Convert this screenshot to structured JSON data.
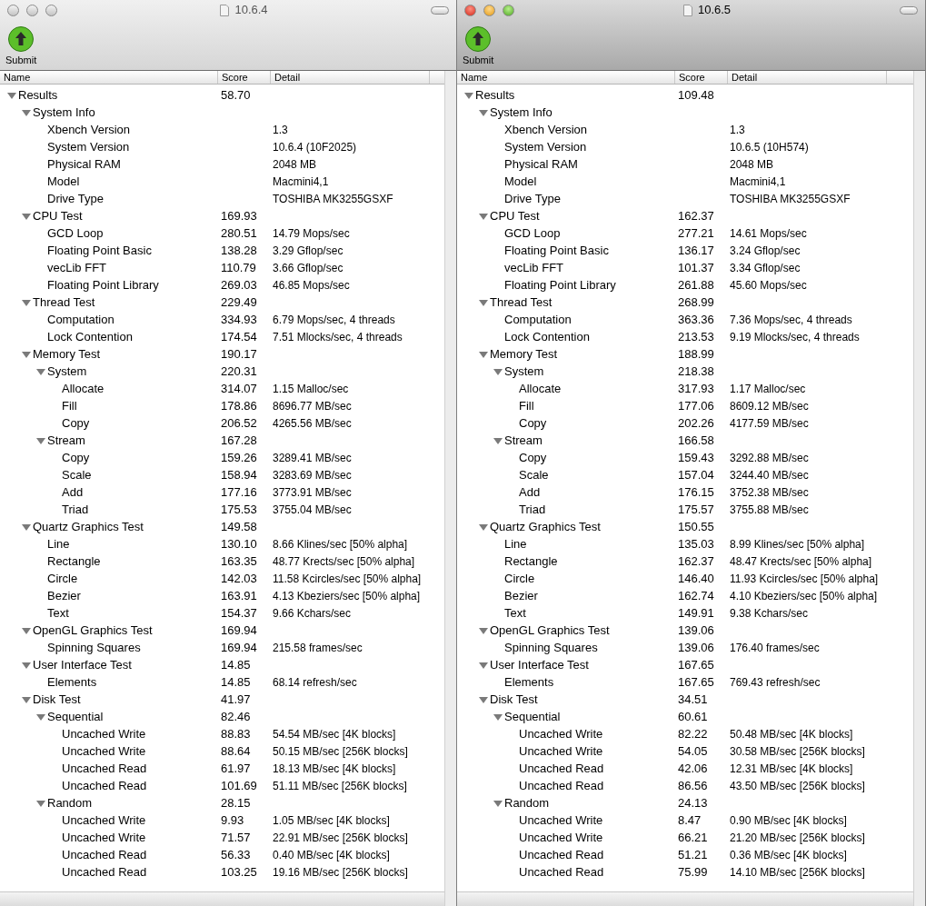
{
  "windows": [
    {
      "title": "10.6.4",
      "active": false,
      "toolbar": [
        {
          "label": "Submit"
        }
      ],
      "columns": [
        "Name",
        "Score",
        "Detail"
      ],
      "rows": [
        {
          "name": "Results",
          "score": "58.70",
          "expanded": true,
          "children": [
            {
              "name": "System Info",
              "expanded": true,
              "children": [
                {
                  "name": "Xbench Version",
                  "detail": "1.3"
                },
                {
                  "name": "System Version",
                  "detail": "10.6.4 (10F2025)"
                },
                {
                  "name": "Physical RAM",
                  "detail": "2048 MB"
                },
                {
                  "name": "Model",
                  "detail": "Macmini4,1"
                },
                {
                  "name": "Drive Type",
                  "detail": "TOSHIBA MK3255GSXF"
                }
              ]
            },
            {
              "name": "CPU Test",
              "score": "169.93",
              "expanded": true,
              "children": [
                {
                  "name": "GCD Loop",
                  "score": "280.51",
                  "detail": "14.79 Mops/sec"
                },
                {
                  "name": "Floating Point Basic",
                  "score": "138.28",
                  "detail": "3.29 Gflop/sec"
                },
                {
                  "name": "vecLib FFT",
                  "score": "110.79",
                  "detail": "3.66 Gflop/sec"
                },
                {
                  "name": "Floating Point Library",
                  "score": "269.03",
                  "detail": "46.85 Mops/sec"
                }
              ]
            },
            {
              "name": "Thread Test",
              "score": "229.49",
              "expanded": true,
              "children": [
                {
                  "name": "Computation",
                  "score": "334.93",
                  "detail": "6.79 Mops/sec, 4 threads"
                },
                {
                  "name": "Lock Contention",
                  "score": "174.54",
                  "detail": "7.51 Mlocks/sec, 4 threads"
                }
              ]
            },
            {
              "name": "Memory Test",
              "score": "190.17",
              "expanded": true,
              "children": [
                {
                  "name": "System",
                  "score": "220.31",
                  "expanded": true,
                  "children": [
                    {
                      "name": "Allocate",
                      "score": "314.07",
                      "detail": "1.15 Malloc/sec"
                    },
                    {
                      "name": "Fill",
                      "score": "178.86",
                      "detail": "8696.77 MB/sec"
                    },
                    {
                      "name": "Copy",
                      "score": "206.52",
                      "detail": "4265.56 MB/sec"
                    }
                  ]
                },
                {
                  "name": "Stream",
                  "score": "167.28",
                  "expanded": true,
                  "children": [
                    {
                      "name": "Copy",
                      "score": "159.26",
                      "detail": "3289.41 MB/sec"
                    },
                    {
                      "name": "Scale",
                      "score": "158.94",
                      "detail": "3283.69 MB/sec"
                    },
                    {
                      "name": "Add",
                      "score": "177.16",
                      "detail": "3773.91 MB/sec"
                    },
                    {
                      "name": "Triad",
                      "score": "175.53",
                      "detail": "3755.04 MB/sec"
                    }
                  ]
                }
              ]
            },
            {
              "name": "Quartz Graphics Test",
              "score": "149.58",
              "expanded": true,
              "children": [
                {
                  "name": "Line",
                  "score": "130.10",
                  "detail": "8.66 Klines/sec [50% alpha]"
                },
                {
                  "name": "Rectangle",
                  "score": "163.35",
                  "detail": "48.77 Krects/sec [50% alpha]"
                },
                {
                  "name": "Circle",
                  "score": "142.03",
                  "detail": "11.58 Kcircles/sec [50% alpha]"
                },
                {
                  "name": "Bezier",
                  "score": "163.91",
                  "detail": "4.13 Kbeziers/sec [50% alpha]"
                },
                {
                  "name": "Text",
                  "score": "154.37",
                  "detail": "9.66 Kchars/sec"
                }
              ]
            },
            {
              "name": "OpenGL Graphics Test",
              "score": "169.94",
              "expanded": true,
              "children": [
                {
                  "name": "Spinning Squares",
                  "score": "169.94",
                  "detail": "215.58 frames/sec"
                }
              ]
            },
            {
              "name": "User Interface Test",
              "score": "14.85",
              "expanded": true,
              "children": [
                {
                  "name": "Elements",
                  "score": "14.85",
                  "detail": "68.14 refresh/sec"
                }
              ]
            },
            {
              "name": "Disk Test",
              "score": "41.97",
              "expanded": true,
              "children": [
                {
                  "name": "Sequential",
                  "score": "82.46",
                  "expanded": true,
                  "children": [
                    {
                      "name": "Uncached Write",
                      "score": "88.83",
                      "detail": "54.54 MB/sec [4K blocks]"
                    },
                    {
                      "name": "Uncached Write",
                      "score": "88.64",
                      "detail": "50.15 MB/sec [256K blocks]"
                    },
                    {
                      "name": "Uncached Read",
                      "score": "61.97",
                      "detail": "18.13 MB/sec [4K blocks]"
                    },
                    {
                      "name": "Uncached Read",
                      "score": "101.69",
                      "detail": "51.11 MB/sec [256K blocks]"
                    }
                  ]
                },
                {
                  "name": "Random",
                  "score": "28.15",
                  "expanded": true,
                  "children": [
                    {
                      "name": "Uncached Write",
                      "score": "9.93",
                      "detail": "1.05 MB/sec [4K blocks]"
                    },
                    {
                      "name": "Uncached Write",
                      "score": "71.57",
                      "detail": "22.91 MB/sec [256K blocks]"
                    },
                    {
                      "name": "Uncached Read",
                      "score": "56.33",
                      "detail": "0.40 MB/sec [4K blocks]"
                    },
                    {
                      "name": "Uncached Read",
                      "score": "103.25",
                      "detail": "19.16 MB/sec [256K blocks]"
                    }
                  ]
                }
              ]
            }
          ]
        }
      ]
    },
    {
      "title": "10.6.5",
      "active": true,
      "toolbar": [
        {
          "label": "Submit"
        }
      ],
      "columns": [
        "Name",
        "Score",
        "Detail"
      ],
      "rows": [
        {
          "name": "Results",
          "score": "109.48",
          "expanded": true,
          "children": [
            {
              "name": "System Info",
              "expanded": true,
              "children": [
                {
                  "name": "Xbench Version",
                  "detail": "1.3"
                },
                {
                  "name": "System Version",
                  "detail": "10.6.5 (10H574)"
                },
                {
                  "name": "Physical RAM",
                  "detail": "2048 MB"
                },
                {
                  "name": "Model",
                  "detail": "Macmini4,1"
                },
                {
                  "name": "Drive Type",
                  "detail": "TOSHIBA MK3255GSXF"
                }
              ]
            },
            {
              "name": "CPU Test",
              "score": "162.37",
              "expanded": true,
              "children": [
                {
                  "name": "GCD Loop",
                  "score": "277.21",
                  "detail": "14.61 Mops/sec"
                },
                {
                  "name": "Floating Point Basic",
                  "score": "136.17",
                  "detail": "3.24 Gflop/sec"
                },
                {
                  "name": "vecLib FFT",
                  "score": "101.37",
                  "detail": "3.34 Gflop/sec"
                },
                {
                  "name": "Floating Point Library",
                  "score": "261.88",
                  "detail": "45.60 Mops/sec"
                }
              ]
            },
            {
              "name": "Thread Test",
              "score": "268.99",
              "expanded": true,
              "children": [
                {
                  "name": "Computation",
                  "score": "363.36",
                  "detail": "7.36 Mops/sec, 4 threads"
                },
                {
                  "name": "Lock Contention",
                  "score": "213.53",
                  "detail": "9.19 Mlocks/sec, 4 threads"
                }
              ]
            },
            {
              "name": "Memory Test",
              "score": "188.99",
              "expanded": true,
              "children": [
                {
                  "name": "System",
                  "score": "218.38",
                  "expanded": true,
                  "children": [
                    {
                      "name": "Allocate",
                      "score": "317.93",
                      "detail": "1.17 Malloc/sec"
                    },
                    {
                      "name": "Fill",
                      "score": "177.06",
                      "detail": "8609.12 MB/sec"
                    },
                    {
                      "name": "Copy",
                      "score": "202.26",
                      "detail": "4177.59 MB/sec"
                    }
                  ]
                },
                {
                  "name": "Stream",
                  "score": "166.58",
                  "expanded": true,
                  "children": [
                    {
                      "name": "Copy",
                      "score": "159.43",
                      "detail": "3292.88 MB/sec"
                    },
                    {
                      "name": "Scale",
                      "score": "157.04",
                      "detail": "3244.40 MB/sec"
                    },
                    {
                      "name": "Add",
                      "score": "176.15",
                      "detail": "3752.38 MB/sec"
                    },
                    {
                      "name": "Triad",
                      "score": "175.57",
                      "detail": "3755.88 MB/sec"
                    }
                  ]
                }
              ]
            },
            {
              "name": "Quartz Graphics Test",
              "score": "150.55",
              "expanded": true,
              "children": [
                {
                  "name": "Line",
                  "score": "135.03",
                  "detail": "8.99 Klines/sec [50% alpha]"
                },
                {
                  "name": "Rectangle",
                  "score": "162.37",
                  "detail": "48.47 Krects/sec [50% alpha]"
                },
                {
                  "name": "Circle",
                  "score": "146.40",
                  "detail": "11.93 Kcircles/sec [50% alpha]"
                },
                {
                  "name": "Bezier",
                  "score": "162.74",
                  "detail": "4.10 Kbeziers/sec [50% alpha]"
                },
                {
                  "name": "Text",
                  "score": "149.91",
                  "detail": "9.38 Kchars/sec"
                }
              ]
            },
            {
              "name": "OpenGL Graphics Test",
              "score": "139.06",
              "expanded": true,
              "children": [
                {
                  "name": "Spinning Squares",
                  "score": "139.06",
                  "detail": "176.40 frames/sec"
                }
              ]
            },
            {
              "name": "User Interface Test",
              "score": "167.65",
              "expanded": true,
              "children": [
                {
                  "name": "Elements",
                  "score": "167.65",
                  "detail": "769.43 refresh/sec"
                }
              ]
            },
            {
              "name": "Disk Test",
              "score": "34.51",
              "expanded": true,
              "children": [
                {
                  "name": "Sequential",
                  "score": "60.61",
                  "expanded": true,
                  "children": [
                    {
                      "name": "Uncached Write",
                      "score": "82.22",
                      "detail": "50.48 MB/sec [4K blocks]"
                    },
                    {
                      "name": "Uncached Write",
                      "score": "54.05",
                      "detail": "30.58 MB/sec [256K blocks]"
                    },
                    {
                      "name": "Uncached Read",
                      "score": "42.06",
                      "detail": "12.31 MB/sec [4K blocks]"
                    },
                    {
                      "name": "Uncached Read",
                      "score": "86.56",
                      "detail": "43.50 MB/sec [256K blocks]"
                    }
                  ]
                },
                {
                  "name": "Random",
                  "score": "24.13",
                  "expanded": true,
                  "children": [
                    {
                      "name": "Uncached Write",
                      "score": "8.47",
                      "detail": "0.90 MB/sec [4K blocks]"
                    },
                    {
                      "name": "Uncached Write",
                      "score": "66.21",
                      "detail": "21.20 MB/sec [256K blocks]"
                    },
                    {
                      "name": "Uncached Read",
                      "score": "51.21",
                      "detail": "0.36 MB/sec [4K blocks]"
                    },
                    {
                      "name": "Uncached Read",
                      "score": "75.99",
                      "detail": "14.10 MB/sec [256K blocks]"
                    }
                  ]
                }
              ]
            }
          ]
        }
      ]
    }
  ]
}
